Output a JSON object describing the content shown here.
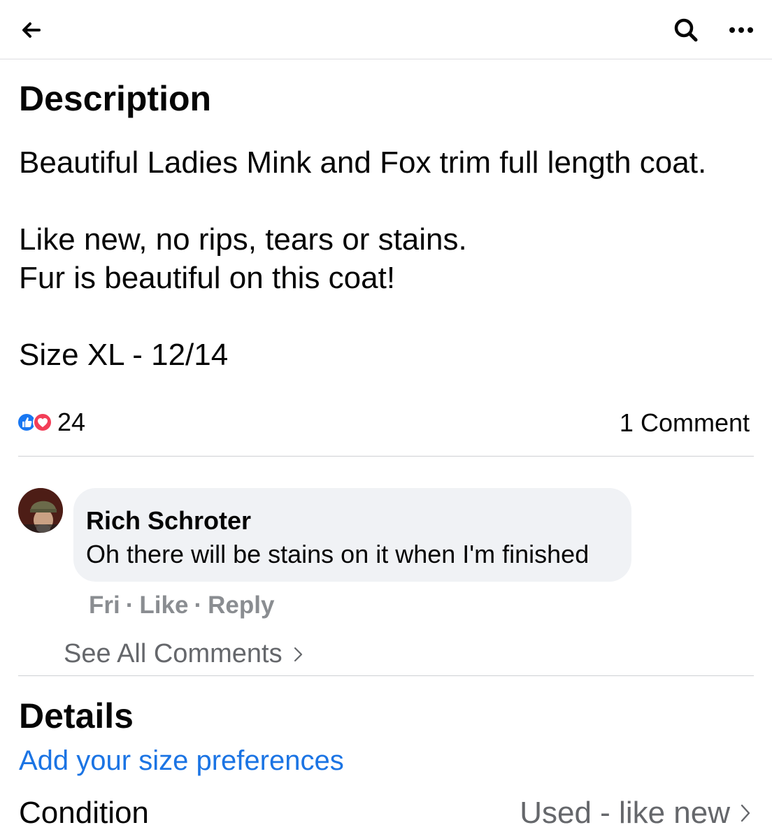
{
  "header": {
    "back_icon": "arrow-left-icon",
    "search_icon": "search-icon",
    "more_icon": "more-dots-icon"
  },
  "description": {
    "title": "Description",
    "body": "Beautiful Ladies Mink and Fox trim full length coat.\n\nLike new, no rips, tears or stains.\nFur is beautiful on this coat!\n\nSize XL - 12/14"
  },
  "reactions": {
    "icons": [
      "like-icon",
      "love-icon"
    ],
    "count": "24",
    "comments": "1 Comment",
    "like_color": "#1877f2",
    "love_color": "#f33e58"
  },
  "comment": {
    "author": "Rich Schroter",
    "text": "Oh there will be stains on it when I'm finished",
    "time": "Fri",
    "like": "Like",
    "reply": "Reply",
    "separator": "·"
  },
  "see_all": "See All Comments",
  "details": {
    "title": "Details",
    "size_link": "Add your size preferences",
    "condition_label": "Condition",
    "condition_value": "Used - like new",
    "link_color": "#1b74e4"
  }
}
